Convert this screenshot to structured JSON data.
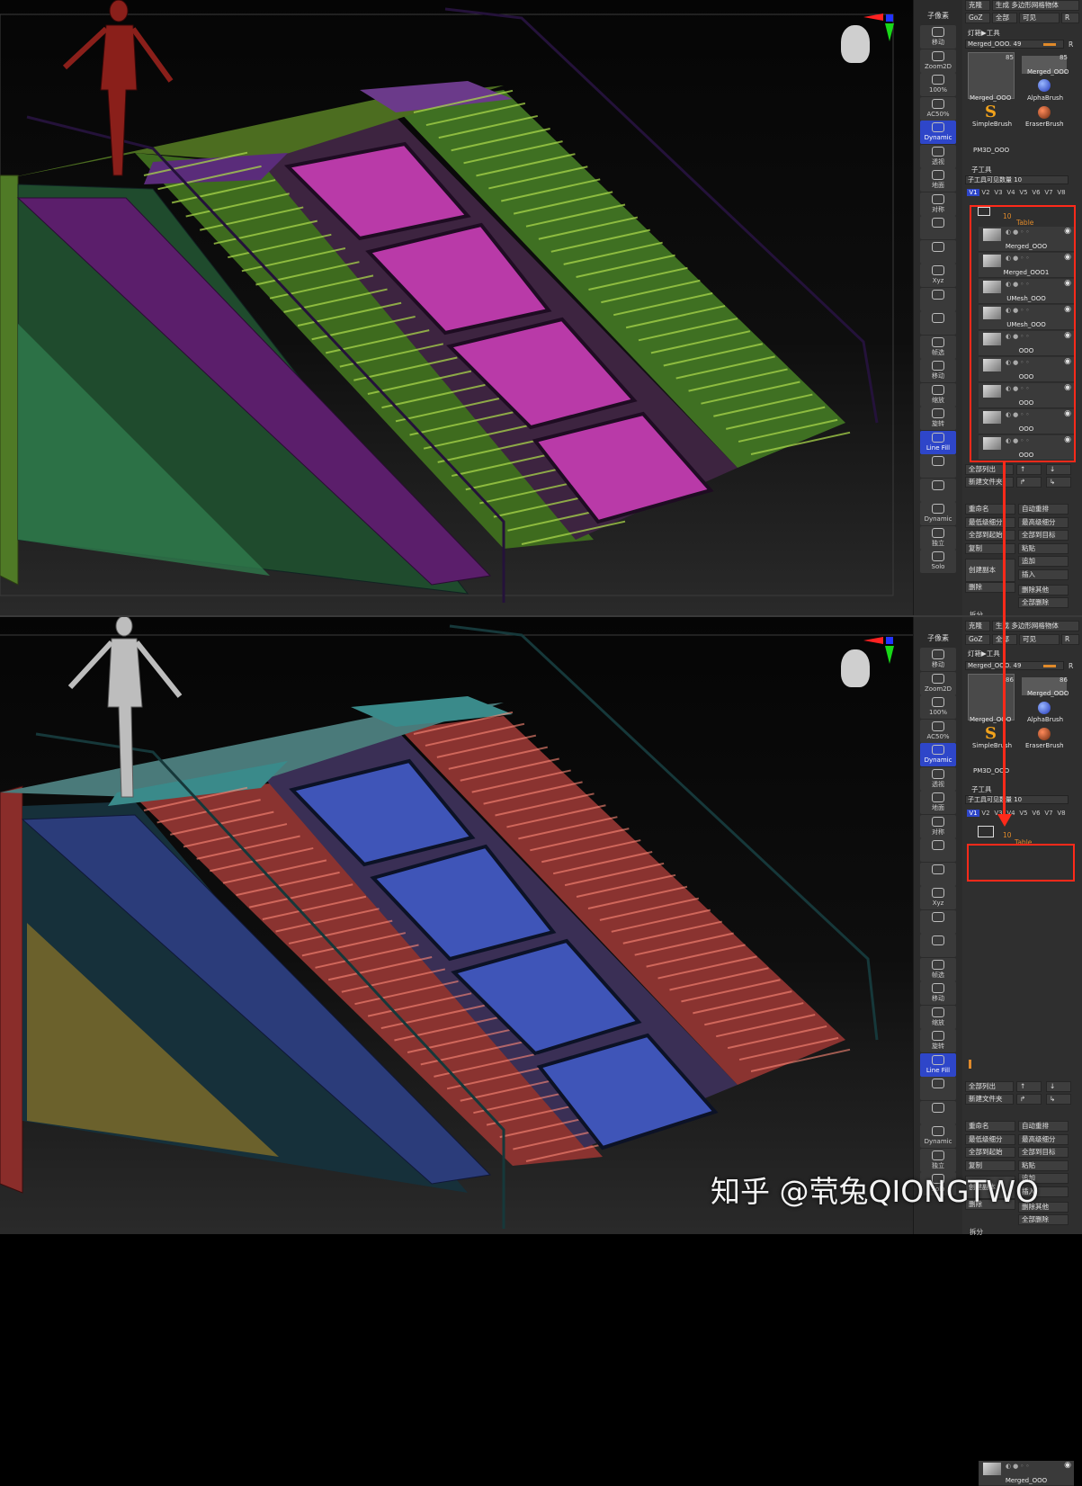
{
  "top": {
    "left_toolbar": {
      "top_label": "子像素",
      "buttons": [
        "移动",
        "Zoom2D",
        "100%",
        "AC50%",
        "Dynamic",
        "透视",
        "地面",
        "对称",
        "",
        "",
        "Xyz",
        "",
        "",
        "帧选",
        "移动",
        "缩放",
        "旋转",
        "Line Fill",
        "",
        "",
        "Dynamic",
        "独立",
        "Solo"
      ],
      "dynamic_label": "Dynamic",
      "linefill_label": "Line Fill"
    },
    "panel": {
      "header_buttons": [
        "克隆",
        "生成 多边形网格物体",
        "GoZ",
        "全部",
        "可见",
        "R"
      ],
      "lightbox_label": "灯箱▶工具",
      "current_tool": "Merged_OOO. 49",
      "current_tool_r": "R",
      "thumbs": [
        {
          "name": "Merged_OOO",
          "count": "85"
        },
        {
          "name": "Merged_OOO",
          "count": "85"
        },
        {
          "name": "AlphaBrush"
        },
        {
          "name": "SimpleBrush"
        },
        {
          "name": "EraserBrush"
        },
        {
          "name": "PM3D_OOO"
        }
      ],
      "subtool_header": "子工具",
      "visible_count": "子工具可见数量 10",
      "version_tabs": [
        "V1",
        "V2",
        "V3",
        "V4",
        "V5",
        "V6",
        "V7",
        "V8"
      ],
      "folder_count": "10",
      "folder_name": "Table",
      "subtools": [
        "Merged_OOO",
        "Merged_OOO1",
        "UMesh_OOO",
        "UMesh_OOO",
        "OOO",
        "OOO",
        "OOO",
        "OOO",
        "OOO"
      ],
      "list_buttons": [
        "全部列出",
        "↑",
        "↓",
        "新建文件夹",
        "↱",
        "↳"
      ],
      "action_buttons": [
        "重命名",
        "自动重排",
        "最低级细分",
        "最高级细分",
        "全部到起始",
        "全部到目标",
        "复制",
        "粘贴",
        "创建副本",
        "追加",
        "插入",
        "删除",
        "删除其他",
        "全部删除"
      ],
      "split_label": "拆分"
    }
  },
  "bottom": {
    "panel": {
      "header_buttons": [
        "克隆",
        "生成 多边形网格物体",
        "GoZ",
        "全部",
        "可见",
        "R"
      ],
      "lightbox_label": "灯箱▶工具",
      "current_tool": "Merged_OOO. 49",
      "current_tool_r": "R",
      "thumbs": [
        {
          "name": "Merged_OOO",
          "count": "86"
        },
        {
          "name": "Merged_OOO",
          "count": "86"
        },
        {
          "name": "AlphaBrush"
        },
        {
          "name": "SimpleBrush"
        },
        {
          "name": "EraserBrush"
        },
        {
          "name": "PM3D_OOO"
        }
      ],
      "subtool_header": "子工具",
      "visible_count": "子工具可见数量 10",
      "version_tabs": [
        "V1",
        "V2",
        "V3",
        "V4",
        "V5",
        "V6",
        "V7",
        "V8"
      ],
      "folder_count": "10",
      "folder_name": "Table",
      "subtools": [
        "Merged_OOO"
      ],
      "list_buttons": [
        "全部列出",
        "↑",
        "↓",
        "新建文件夹",
        "↱",
        "↳"
      ],
      "action_buttons": [
        "重命名",
        "自动重排",
        "最低级细分",
        "最高级细分",
        "全部到起始",
        "全部到目标",
        "复制",
        "粘贴",
        "创建副本",
        "追加",
        "插入",
        "删除",
        "删除其他",
        "全部删除"
      ],
      "split_label": "拆分"
    }
  },
  "watermark": "知乎 @茕兔QIONGTWO",
  "colors": {
    "highlight_red": "#ff2a1a",
    "active_blue": "#2e46c9",
    "slider_orange": "#e08a2a"
  }
}
